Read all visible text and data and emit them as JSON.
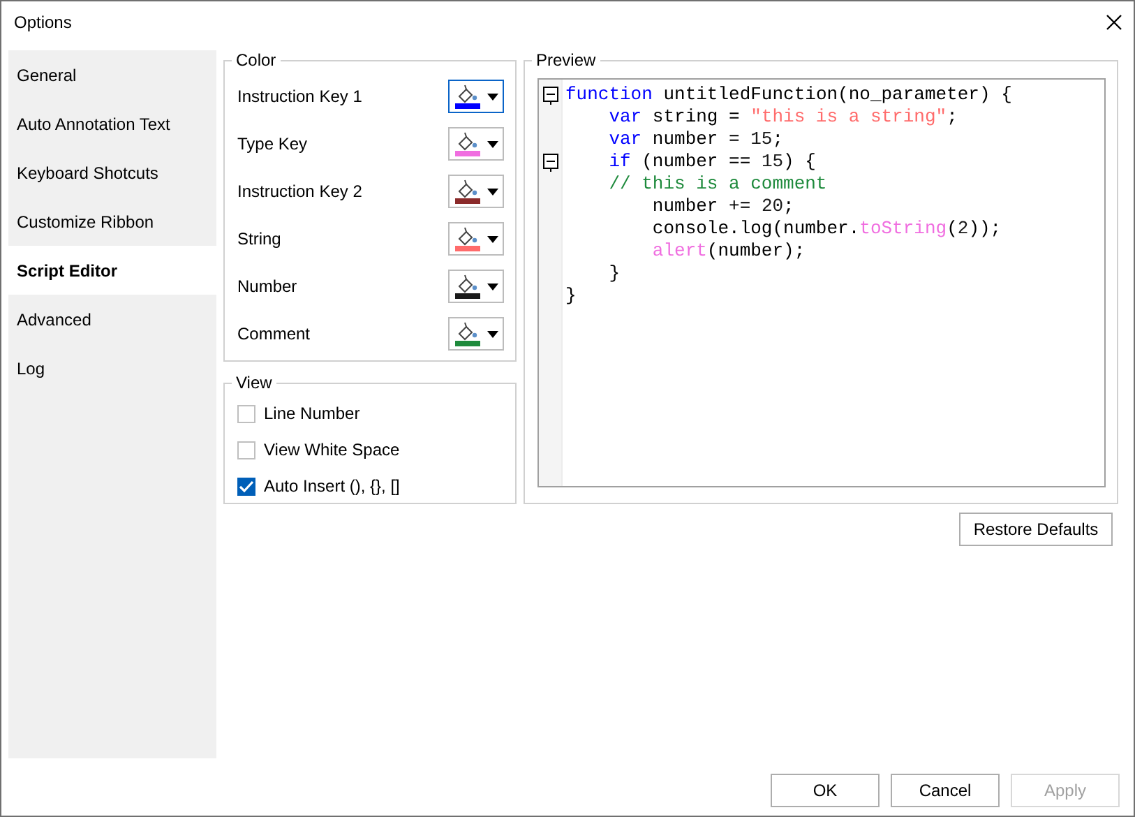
{
  "window": {
    "title": "Options"
  },
  "sidebar": {
    "items": [
      {
        "label": "General",
        "selected": false
      },
      {
        "label": "Auto Annotation Text",
        "selected": false
      },
      {
        "label": "Keyboard Shotcuts",
        "selected": false
      },
      {
        "label": "Customize Ribbon",
        "selected": false
      },
      {
        "label": "Script Editor",
        "selected": true
      },
      {
        "label": "Advanced",
        "selected": false
      },
      {
        "label": "Log",
        "selected": false
      }
    ]
  },
  "color_group": {
    "title": "Color",
    "items": [
      {
        "label": "Instruction Key 1",
        "color": "#0000ff",
        "selected": true
      },
      {
        "label": "Type Key",
        "color": "#f06ee0",
        "selected": false
      },
      {
        "label": "Instruction Key 2",
        "color": "#8b2a2a",
        "selected": false
      },
      {
        "label": "String",
        "color": "#ff6b6b",
        "selected": false
      },
      {
        "label": "Number",
        "color": "#1a1a1a",
        "selected": false
      },
      {
        "label": "Comment",
        "color": "#1e8a3c",
        "selected": false
      }
    ]
  },
  "view_group": {
    "title": "View",
    "options": [
      {
        "label": "Line Number",
        "checked": false
      },
      {
        "label": "View White Space",
        "checked": false
      },
      {
        "label": "Auto Insert (), {}, []",
        "checked": true
      }
    ]
  },
  "preview": {
    "title": "Preview",
    "lines": [
      {
        "fold": true,
        "segments": [
          {
            "kind": "key1",
            "text": "function"
          },
          {
            "kind": "plain",
            "text": " untitledFunction(no_parameter) {"
          }
        ]
      },
      {
        "fold": false,
        "segments": [
          {
            "kind": "key1",
            "text": "    var"
          },
          {
            "kind": "plain",
            "text": " string = "
          },
          {
            "kind": "string",
            "text": "\"this is a string\""
          },
          {
            "kind": "plain",
            "text": ";"
          }
        ]
      },
      {
        "fold": false,
        "segments": [
          {
            "kind": "key1",
            "text": "    var"
          },
          {
            "kind": "plain",
            "text": " number = "
          },
          {
            "kind": "number",
            "text": "15"
          },
          {
            "kind": "plain",
            "text": ";"
          }
        ]
      },
      {
        "fold": true,
        "segments": [
          {
            "kind": "key1",
            "text": "    if"
          },
          {
            "kind": "plain",
            "text": " (number == "
          },
          {
            "kind": "number",
            "text": "15"
          },
          {
            "kind": "plain",
            "text": ") {"
          }
        ]
      },
      {
        "fold": false,
        "segments": [
          {
            "kind": "comment",
            "text": "    // this is a comment"
          }
        ]
      },
      {
        "fold": false,
        "segments": [
          {
            "kind": "plain",
            "text": "        number += "
          },
          {
            "kind": "number",
            "text": "20"
          },
          {
            "kind": "plain",
            "text": ";"
          }
        ]
      },
      {
        "fold": false,
        "segments": [
          {
            "kind": "plain",
            "text": "        console.log(number."
          },
          {
            "kind": "type",
            "text": "toString"
          },
          {
            "kind": "plain",
            "text": "("
          },
          {
            "kind": "number",
            "text": "2"
          },
          {
            "kind": "plain",
            "text": "));"
          }
        ]
      },
      {
        "fold": false,
        "segments": [
          {
            "kind": "type",
            "text": "        alert"
          },
          {
            "kind": "plain",
            "text": "(number);"
          }
        ]
      },
      {
        "fold": false,
        "segments": [
          {
            "kind": "plain",
            "text": "    }"
          }
        ]
      },
      {
        "fold": false,
        "segments": [
          {
            "kind": "plain",
            "text": "}"
          }
        ]
      }
    ]
  },
  "restore_button": "Restore Defaults",
  "buttons": [
    {
      "label": "OK",
      "disabled": false
    },
    {
      "label": "Cancel",
      "disabled": false
    },
    {
      "label": "Apply",
      "disabled": true
    }
  ]
}
